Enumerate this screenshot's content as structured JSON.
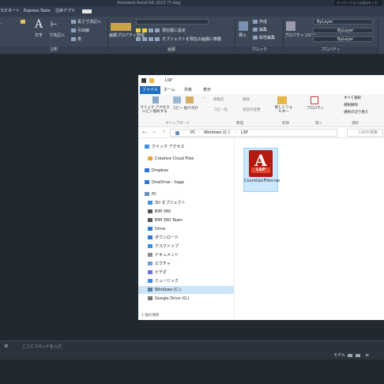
{
  "app": {
    "title": "Autodesk AutoCAD 2022    ??.dwg",
    "search_placeholder": "キーワードまたは語句を入力"
  },
  "tabs": [
    "ラビネート",
    "Express Tools",
    "注目アプリ"
  ],
  "ribbon": {
    "panels": [
      "注釈",
      "画層",
      "ブロック",
      "プロパティ"
    ],
    "items": {
      "text": "文字",
      "dimension": "寸法記入",
      "leader": "引出線",
      "table": "表",
      "dim_style": "長さ寸法記入",
      "layer_props": "画層プロパティ管理",
      "set_current": "現在層に設定",
      "match_layer": "オブジェクトを現在の画層に移動",
      "insert": "挿入",
      "create": "作成",
      "edit": "編集",
      "edit_attr": "属性編集",
      "match_props": "プロパティコピー",
      "bylayer1": "ByLayer",
      "bylayer2": "ByLayer",
      "bylayer3": "ByLayer"
    }
  },
  "command_placeholder": "ここにコマンドを入力",
  "status": {
    "model": "モデル"
  },
  "explorer": {
    "title": "LSP",
    "menu_tabs": [
      "ファイル",
      "ホーム",
      "共有",
      "表示"
    ],
    "ribbon_groups": [
      "クリップボード",
      "整理",
      "新規",
      "開く",
      "選択"
    ],
    "ribbon_buttons": {
      "quick_access": "クイック アクセスにピン留めする",
      "copy": "コピー",
      "paste": "貼り付け",
      "move_to": "移動先",
      "copy_to": "コピー先",
      "delete": "削除",
      "rename": "名前の変更",
      "new_folder": "新しいフォルダー",
      "properties": "プロパティ",
      "select_all": "すべて選択",
      "select_none": "選択解除",
      "invert": "選択の切り替え"
    },
    "address": [
      "PC",
      "Windows (C:)",
      "LSP"
    ],
    "search_placeholder": "LSPの検索",
    "nav": [
      {
        "label": "クイック アクセス",
        "color": "#3d8ee8"
      },
      {
        "label": "Creative Cloud Files",
        "color": "#e8a33d"
      },
      {
        "label": "Dropbox",
        "color": "#2e6fd8"
      },
      {
        "label": "OneDrive - haga",
        "color": "#2f7ad8"
      },
      {
        "label": "PC",
        "color": "#6a8fbf"
      },
      {
        "label": "3D オブジェクト",
        "color": "#3d8ee8"
      },
      {
        "label": "BIM 360",
        "color": "#555555"
      },
      {
        "label": "BIM 360 Team",
        "color": "#555555"
      },
      {
        "label": "Drive",
        "color": "#2f7ad8"
      },
      {
        "label": "ダウンロード",
        "color": "#2f7ad8"
      },
      {
        "label": "デスクトップ",
        "color": "#3d8ee8"
      },
      {
        "label": "ドキュメント",
        "color": "#8b8b8b"
      },
      {
        "label": "ピクチャ",
        "color": "#6fa3d8"
      },
      {
        "label": "ビデオ",
        "color": "#6f6fd8"
      },
      {
        "label": "ミュージック",
        "color": "#3d8ee8"
      },
      {
        "label": "Windows (C:)",
        "color": "#5b7fa8"
      },
      {
        "label": "Google Drive (G:)",
        "color": "#777777"
      }
    ],
    "selected_nav": "Windows (C:)",
    "item_count": "1 個の項目",
    "file": {
      "icon_letter": "A",
      "icon_badge": "LSP",
      "name": "CountUpLFilter.lsp"
    }
  }
}
